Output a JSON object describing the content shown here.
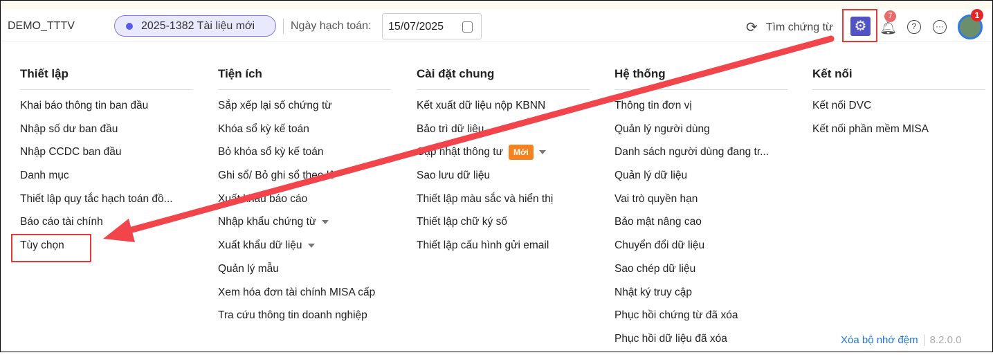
{
  "header": {
    "company": "DEMO_TTTV",
    "document": "2025-1382 Tài liệu mới",
    "date_label": "Ngày hạch toán:",
    "date_value": "15/07/2025",
    "search_label": "Tìm chứng từ",
    "notification_count": "7",
    "avatar_badge": "1"
  },
  "columns": [
    {
      "title": "Thiết lập",
      "items": [
        {
          "label": "Khai báo thông tin ban đầu"
        },
        {
          "label": "Nhập số dư ban đầu"
        },
        {
          "label": "Nhập CCDC ban đầu"
        },
        {
          "label": "Danh mục"
        },
        {
          "label": "Thiết lập quy tắc hạch toán đồ..."
        },
        {
          "label": "Báo cáo tài chính"
        },
        {
          "label": "Tùy chọn"
        }
      ]
    },
    {
      "title": "Tiện ích",
      "items": [
        {
          "label": "Sắp xếp lại số chứng từ"
        },
        {
          "label": "Khóa sổ kỳ kế toán"
        },
        {
          "label": "Bỏ khóa sổ kỳ kế toán"
        },
        {
          "label": "Ghi sổ/ Bỏ ghi sổ theo lô"
        },
        {
          "label": "Xuất khẩu báo cáo"
        },
        {
          "label": "Nhập khẩu chứng từ"
        },
        {
          "label": "Xuất khẩu dữ liệu"
        },
        {
          "label": "Quản lý mẫu"
        },
        {
          "label": "Xem hóa đơn tài chính MISA cấp"
        },
        {
          "label": "Tra cứu thông tin doanh nghiệp"
        }
      ]
    },
    {
      "title": "Cài đặt chung",
      "items": [
        {
          "label": "Kết xuất dữ liệu nộp KBNN"
        },
        {
          "label": "Bảo trì dữ liệu"
        },
        {
          "label": "Cập nhật thông tư",
          "badge": "Mới"
        },
        {
          "label": "Sao lưu dữ liệu"
        },
        {
          "label": "Thiết lập màu sắc và hiển thị"
        },
        {
          "label": "Thiết lập chữ ký số"
        },
        {
          "label": "Thiết lập cấu hình gửi email"
        }
      ]
    },
    {
      "title": "Hệ thống",
      "items": [
        {
          "label": "Thông tin đơn vị"
        },
        {
          "label": "Quản lý người dùng"
        },
        {
          "label": "Danh sách người dùng đang tr..."
        },
        {
          "label": "Quản lý dữ liệu"
        },
        {
          "label": "Vai trò quyền hạn"
        },
        {
          "label": "Bảo mật nâng cao"
        },
        {
          "label": "Chuyển đổi dữ liệu"
        },
        {
          "label": "Sao chép dữ liệu"
        },
        {
          "label": "Nhật ký truy cập"
        },
        {
          "label": "Phục hồi chứng từ đã xóa"
        },
        {
          "label": "Phục hồi dữ liệu đã xóa"
        }
      ]
    },
    {
      "title": "Kết nối",
      "items": [
        {
          "label": "Kết nối DVC"
        },
        {
          "label": "Kết nối phần mềm MISA"
        }
      ]
    }
  ],
  "footer": {
    "clear_cache": "Xóa bộ nhớ đệm",
    "version": "8.2.0.0"
  },
  "colors": {
    "accent": "#5253c3",
    "annotation": "#e53935"
  }
}
